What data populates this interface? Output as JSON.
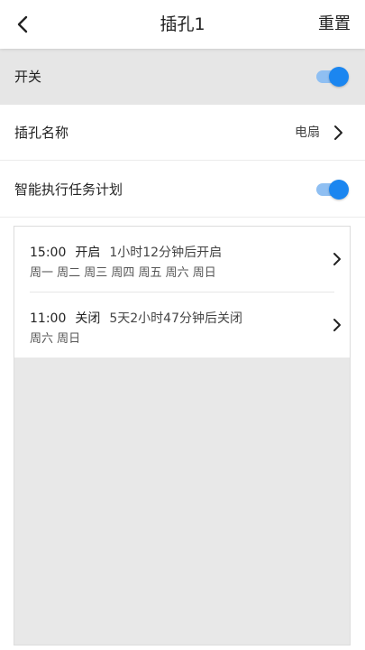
{
  "header": {
    "title": "插孔1",
    "reset_label": "重置"
  },
  "power": {
    "label": "开关",
    "enabled": true
  },
  "socket_name": {
    "label": "插孔名称",
    "value": "电扇"
  },
  "smart_schedule": {
    "label": "智能执行任务计划",
    "enabled": true
  },
  "tasks": [
    {
      "time": "15:00",
      "action": "开启",
      "remaining": "1小时12分钟后开启",
      "days": "周一 周二 周三 周四 周五 周六 周日"
    },
    {
      "time": "11:00",
      "action": "关闭",
      "remaining": "5天2小时47分钟后关闭",
      "days": "周六 周日"
    }
  ],
  "colors": {
    "accent": "#1b86f0",
    "accent_track": "#8fbff2",
    "section_gray": "#e6e6e6"
  },
  "icons": {
    "back": "chevron-left-icon",
    "forward": "chevron-right-icon"
  }
}
